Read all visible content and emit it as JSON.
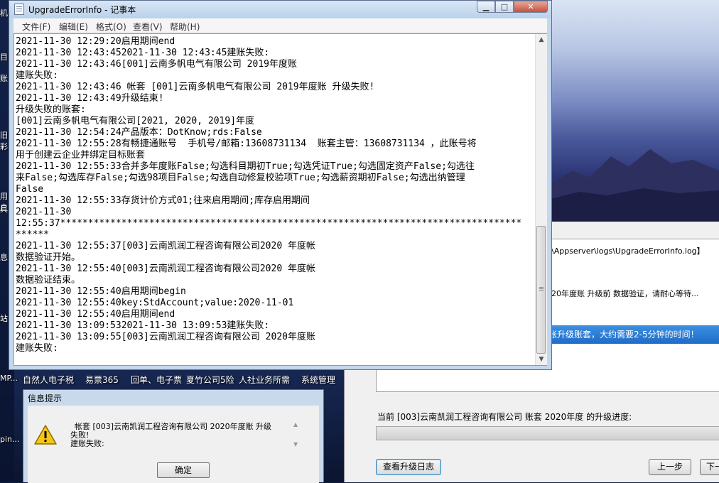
{
  "desktop": {
    "left_labels": [
      "机",
      "目",
      "账",
      "旧",
      "彩",
      "用户",
      "具",
      "息",
      "站",
      "MP...",
      "pin..."
    ],
    "icon_labels": [
      "自然人电子税",
      "易票365",
      "回单、电子票",
      "夏竹公司5险",
      "人社业务所需",
      "系统管理"
    ]
  },
  "background_window": {
    "log_path_fragment": "\\Appserver\\logs\\UpgradeErrorInfo.log】",
    "status_fragment": "20年度账 升级前 数据验证，请耐心等待...",
    "info_bar": "账升级账套，大约需要2-5分钟的时间！",
    "progress_label": "当前 [003]云南凯润工程咨询有限公司 账套 2020年度 的升级进度:",
    "progress": 0,
    "buttons": {
      "view_log": "查看升级日志",
      "prev": "上一步",
      "next": "下一"
    }
  },
  "notepad": {
    "title": "UpgradeErrorInfo - 记事本",
    "menu": [
      "文件(F)",
      "编辑(E)",
      "格式(O)",
      "查看(V)",
      "帮助(H)"
    ],
    "lines": [
      "2021-11-30 12:29:20启用期间end",
      "2021-11-30 12:43:452021-11-30 12:43:45建账失败:",
      "2021-11-30 12:43:46[001]云南多帆电气有限公司 2019年度账",
      "建账失败:",
      "2021-11-30 12:43:46 帐套 [001]云南多帆电气有限公司 2019年度账 升级失败!",
      "2021-11-30 12:43:49升级结束!",
      "升级失败的账套:",
      "[001]云南多帆电气有限公司[2021, 2020, 2019]年度",
      "2021-11-30 12:54:24产品版本：DotKnow;rds:False",
      "2021-11-30 12:55:28有畅捷通账号  手机号/邮箱:13608731134  账套主管：13608731134 ，此账号将",
      "用于创建云企业并绑定目标账套",
      "2021-11-30 12:55:33合并多年度账False;勾选科目期初True;勾选凭证True;勾选固定资产False;勾选往",
      "来False;勾选库存False;勾选98项目False;勾选自动修复校验项True;勾选薪资期初False;勾选出纳管理",
      "False",
      "2021-11-30 12:55:33存货计价方式01;往来启用期间;库存启用期间",
      "2021-11-30",
      "12:55:37***********************************************************************************",
      "******",
      "2021-11-30 12:55:37[003]云南凯润工程咨询有限公司2020 年度帐",
      "数据验证开始。",
      "2021-11-30 12:55:40[003]云南凯润工程咨询有限公司2020 年度帐",
      "数据验证结束。",
      "2021-11-30 12:55:40启用期间begin",
      "2021-11-30 12:55:40key:StdAccount;value:2020-11-01",
      "2021-11-30 12:55:40启用期间end",
      "2021-11-30 13:09:532021-11-30 13:09:53建账失败:",
      "2021-11-30 13:09:55[003]云南凯润工程咨询有限公司 2020年度账",
      "建账失败:"
    ]
  },
  "dialog": {
    "title": "信息提示",
    "message_line1": "帐套 [003]云南凯润工程咨询有限公司 2020年度账 升级",
    "message_line2": "失败!",
    "message_line3": "建账失败:",
    "ok_label": "确定"
  },
  "colors": {
    "accent_bar": "#1f6cc8",
    "titlebar": "#c5d7ec",
    "close_button": "#c7503a"
  }
}
